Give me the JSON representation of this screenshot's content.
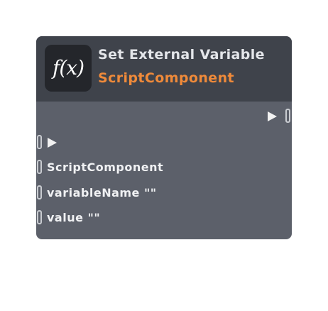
{
  "node": {
    "icon_text": "f(x)",
    "title": "Set External Variable",
    "subtitle": "ScriptComponent",
    "inputs": [
      {
        "label": ""
      },
      {
        "label": "ScriptComponent"
      },
      {
        "label": "variableName \"\""
      },
      {
        "label": "value \"\""
      }
    ]
  },
  "colors": {
    "header_bg": "#3f434b",
    "body_bg": "#5c606a",
    "subtitle": "#ef8a3a",
    "title": "#e4e6ea"
  }
}
